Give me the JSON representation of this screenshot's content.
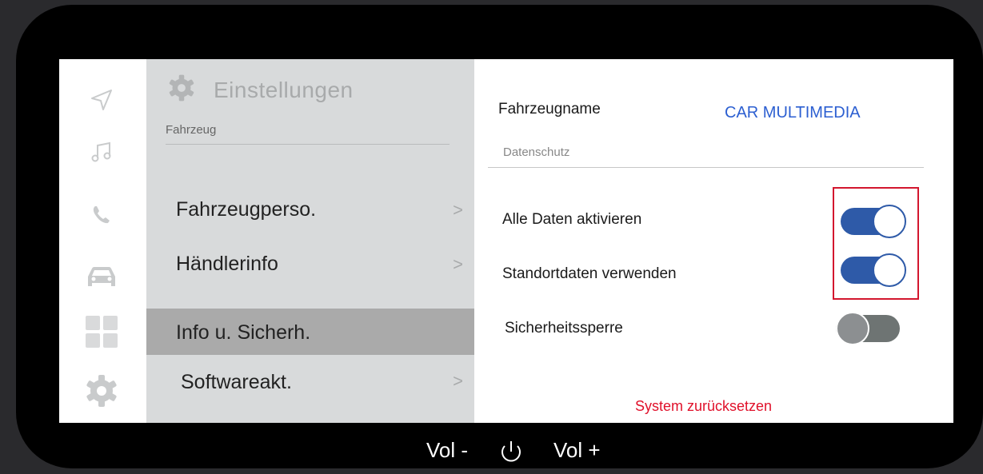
{
  "menu": {
    "title": "Einstellungen",
    "subtitle": "Fahrzeug",
    "items": [
      {
        "label": "Fahrzeugperso.",
        "arrow": ">"
      },
      {
        "label": "Händlerinfo",
        "arrow": ">"
      },
      {
        "label": "Info u. Sicherh.",
        "arrow": ""
      },
      {
        "label": "Softwareakt.",
        "arrow": ">"
      }
    ]
  },
  "content": {
    "vehicle_label": "Fahrzeugname",
    "vehicle_value": "CAR MULTIMEDIA",
    "section": "Datenschutz",
    "settings": [
      {
        "label": "Alle Daten aktivieren",
        "state": "on"
      },
      {
        "label": "Standortdaten verwenden",
        "state": "on"
      },
      {
        "label": "Sicherheitssperre",
        "state": "off"
      }
    ],
    "reset_label": "System zurücksetzen"
  },
  "rail_icons": [
    "navigation-icon",
    "music-icon",
    "phone-icon",
    "car-icon",
    "apps-icon",
    "settings-icon"
  ],
  "bottom": {
    "vol_down": "Vol -",
    "vol_up": "Vol +",
    "power_icon": "power-icon"
  },
  "colors": {
    "accent_blue": "#2c5fd1",
    "toggle_on": "#2e5aa8",
    "warning_red": "#e0102a",
    "menu_bg": "#d8dadb"
  }
}
